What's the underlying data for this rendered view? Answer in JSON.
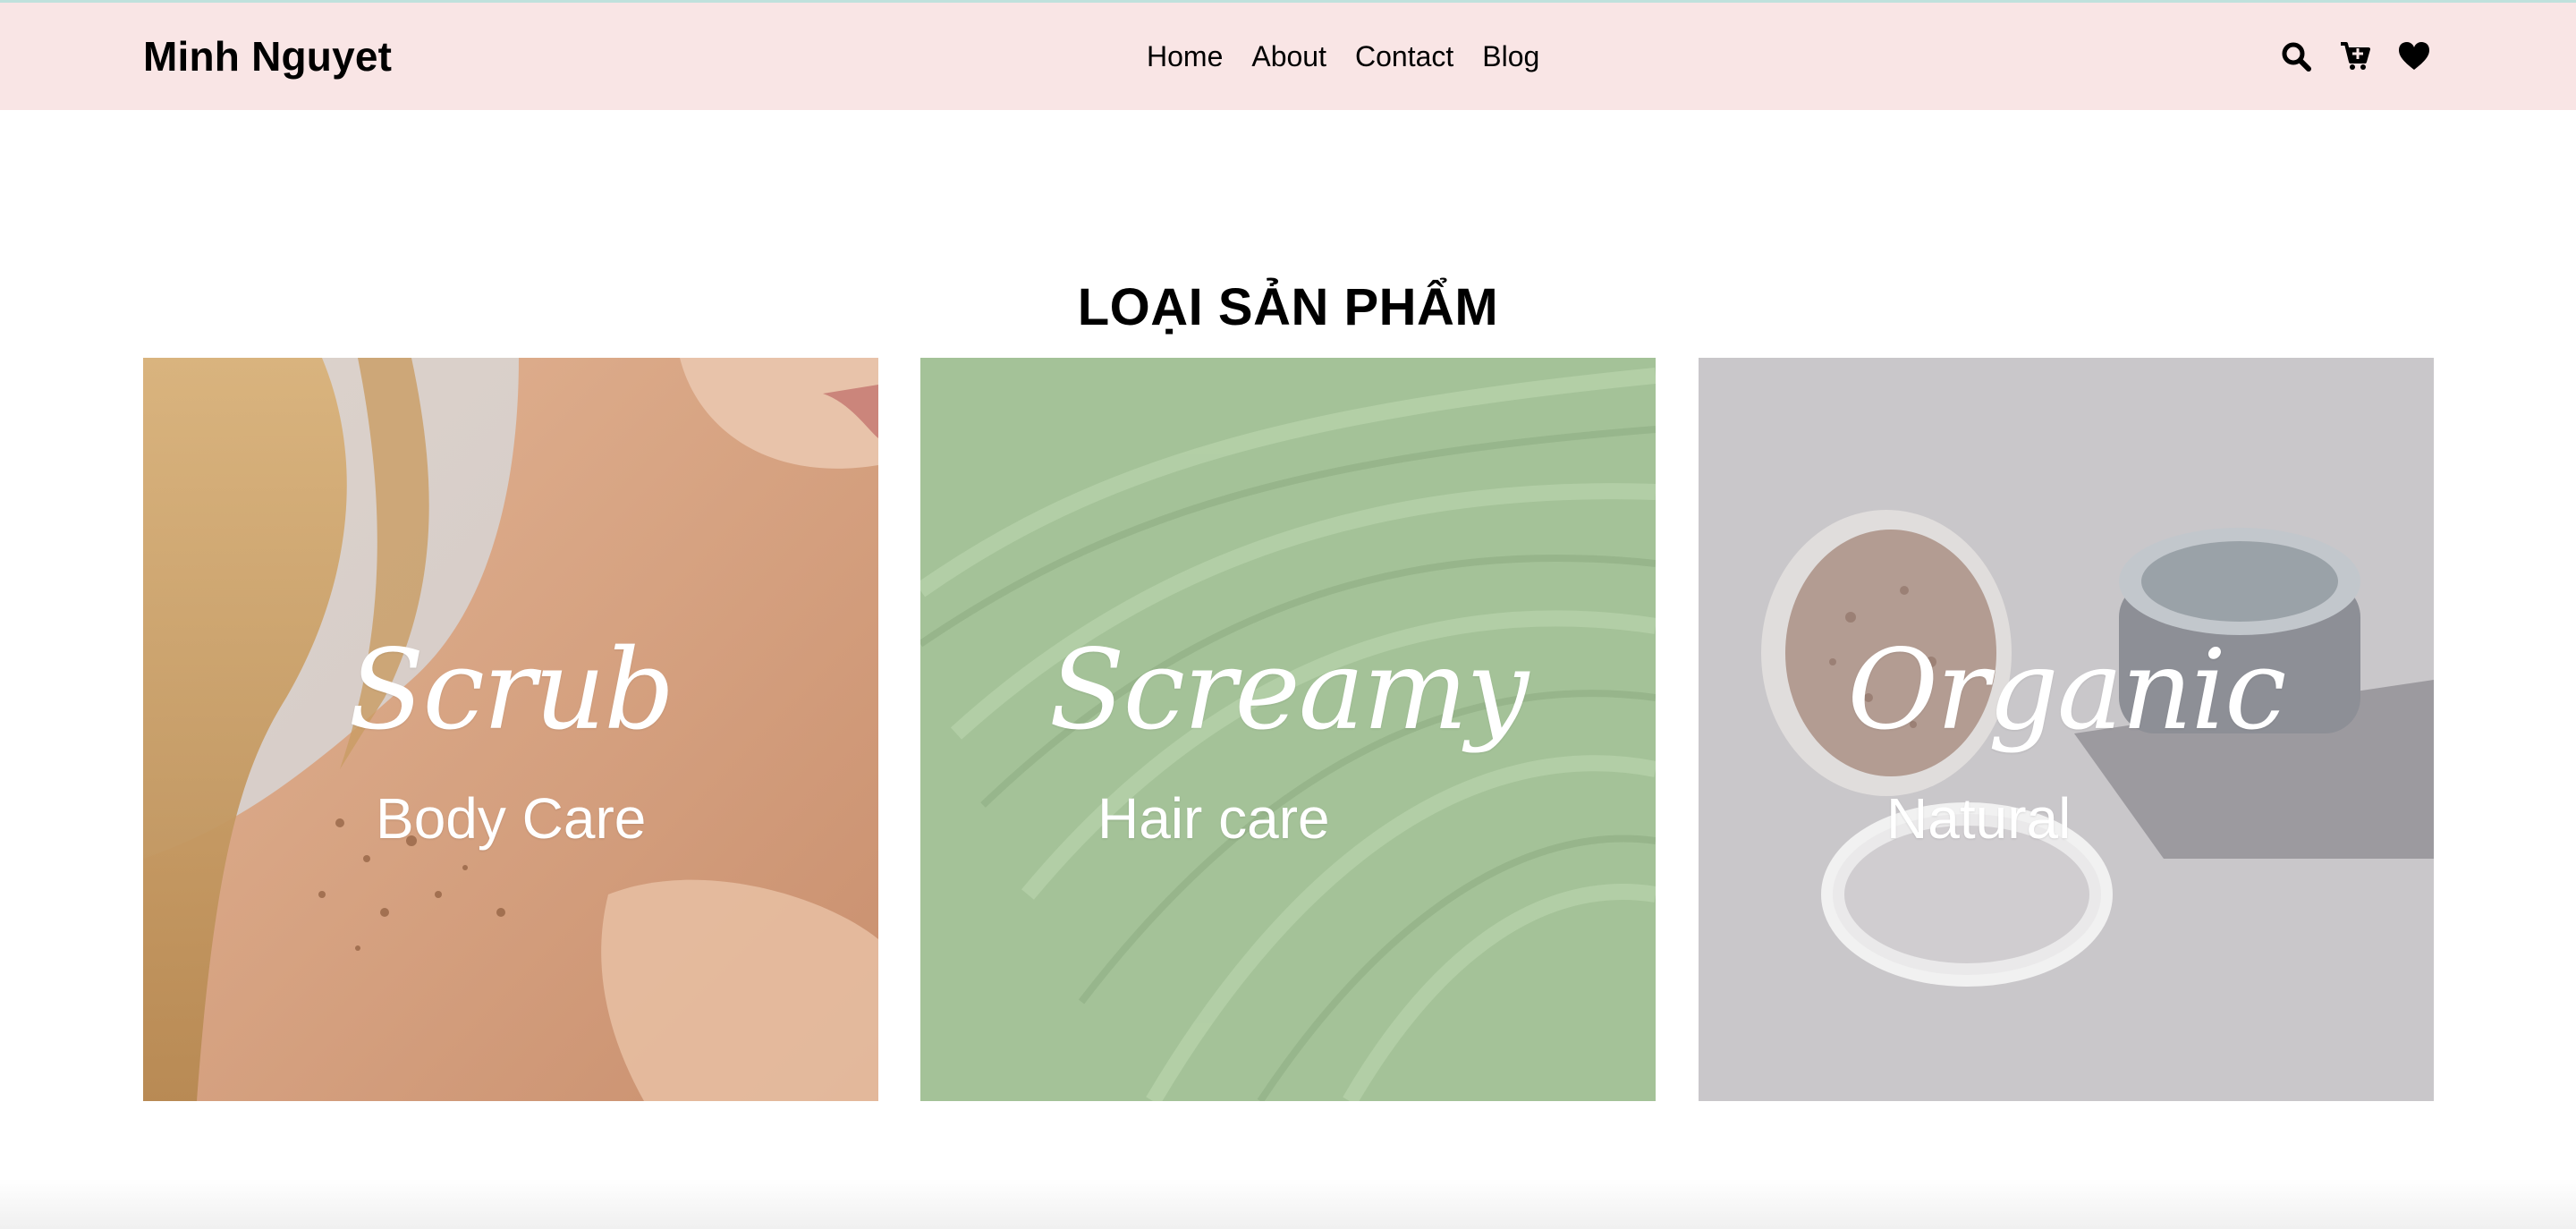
{
  "brand": "Minh Nguyet",
  "nav": {
    "links": [
      "Home",
      "About",
      "Contact",
      "Blog"
    ]
  },
  "icons": [
    "search-icon",
    "cart-icon",
    "heart-icon"
  ],
  "section": {
    "title": "LOẠI SẢN PHẨM"
  },
  "cards": [
    {
      "script": "Scrub",
      "subtitle": "Body Care",
      "color": "#d8b79a"
    },
    {
      "script": "Screamy",
      "subtitle": "Hair care",
      "color": "#9dbb8f"
    },
    {
      "script": "Organic",
      "subtitle": "Natural",
      "color": "#c7c5c8"
    }
  ],
  "colors": {
    "navbar_bg": "#f9e5e5",
    "top_accent": "#bfe1dc"
  }
}
